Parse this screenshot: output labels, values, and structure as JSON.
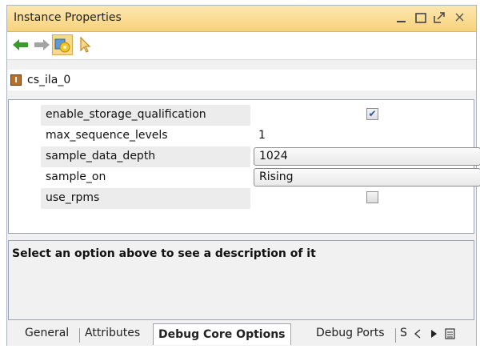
{
  "window": {
    "title": "Instance Properties"
  },
  "window_controls": [
    "minimize",
    "maximize",
    "float",
    "close"
  ],
  "toolbar": {
    "buttons": [
      "back-arrow-icon",
      "forward-arrow-icon",
      "settings-chip-icon",
      "select-cursor-icon"
    ]
  },
  "instance": {
    "icon_letter": "I",
    "name": "cs_ila_0"
  },
  "properties": [
    {
      "label": "enable_storage_qualification",
      "type": "checkbox",
      "checked": true
    },
    {
      "label": "max_sequence_levels",
      "type": "text",
      "value": "1"
    },
    {
      "label": "sample_data_depth",
      "type": "dropdown",
      "value": "1024"
    },
    {
      "label": "sample_on",
      "type": "dropdown",
      "value": "Rising"
    },
    {
      "label": "use_rpms",
      "type": "checkbox",
      "checked": false
    }
  ],
  "description": {
    "text": "Select an option above to see a description of it"
  },
  "tabs": [
    {
      "label": "General",
      "active": false
    },
    {
      "label": "Attributes",
      "active": false
    },
    {
      "label": "Debug Core Options",
      "active": true
    },
    {
      "label": "Debug Ports",
      "active": false
    },
    {
      "label": "S",
      "active": false
    }
  ],
  "colors": {
    "titlebar": "#f8d27c",
    "active_tool": "#f6d98e",
    "back_arrow": "#3a9a2e",
    "forward_arrow": "#9a9a9a",
    "checkbox_mark": "#2a55a8"
  }
}
